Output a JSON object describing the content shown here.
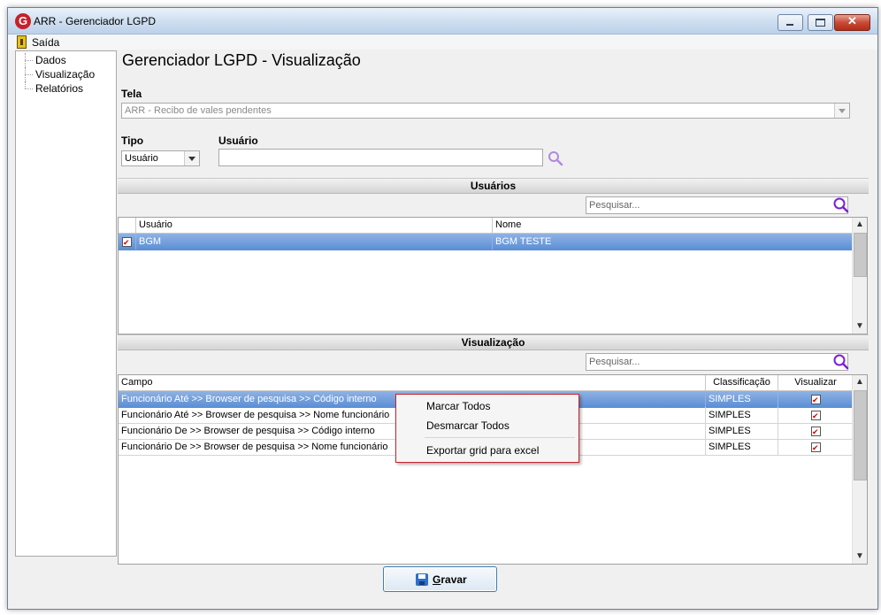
{
  "window": {
    "title": "ARR - Gerenciador LGPD",
    "app_icon_letter": "G",
    "close_glyph": "✕"
  },
  "menu": {
    "exit_label": "Saída"
  },
  "tree": {
    "items": [
      "Dados",
      "Visualização",
      "Relatórios"
    ]
  },
  "page": {
    "title": "Gerenciador LGPD - Visualização",
    "tela_label": "Tela",
    "tela_value": "ARR - Recibo de vales pendentes",
    "tipo_label": "Tipo",
    "tipo_value": "Usuário",
    "usuario_label": "Usuário",
    "usuario_value": ""
  },
  "users_section": {
    "title": "Usuários",
    "search_placeholder": "Pesquisar...",
    "columns": [
      "Usuário",
      "Nome"
    ],
    "rows": [
      {
        "checked": true,
        "usuario": "BGM",
        "nome": "BGM TESTE"
      }
    ]
  },
  "visual_section": {
    "title": "Visualização",
    "search_placeholder": "Pesquisar...",
    "columns": [
      "Campo",
      "Classificação",
      "Visualizar"
    ],
    "rows": [
      {
        "campo": "Funcionário Até >> Browser de pesquisa >> Código interno",
        "classificacao": "SIMPLES",
        "visualizar": true
      },
      {
        "campo": "Funcionário Até >> Browser de pesquisa >> Nome funcionário",
        "classificacao": "SIMPLES",
        "visualizar": true
      },
      {
        "campo": "Funcionário De >> Browser de pesquisa >> Código interno",
        "classificacao": "SIMPLES",
        "visualizar": true
      },
      {
        "campo": "Funcionário De >> Browser de pesquisa >> Nome funcionário",
        "classificacao": "SIMPLES",
        "visualizar": true
      }
    ]
  },
  "context_menu": {
    "items": [
      "Marcar Todos",
      "Desmarcar Todos",
      "Exportar grid para excel"
    ]
  },
  "save_button": {
    "mnemonic": "G",
    "rest": "ravar"
  },
  "colors": {
    "accent": "#8a2be2",
    "selection": "#5c8fd6",
    "context_border": "#c5232d"
  }
}
